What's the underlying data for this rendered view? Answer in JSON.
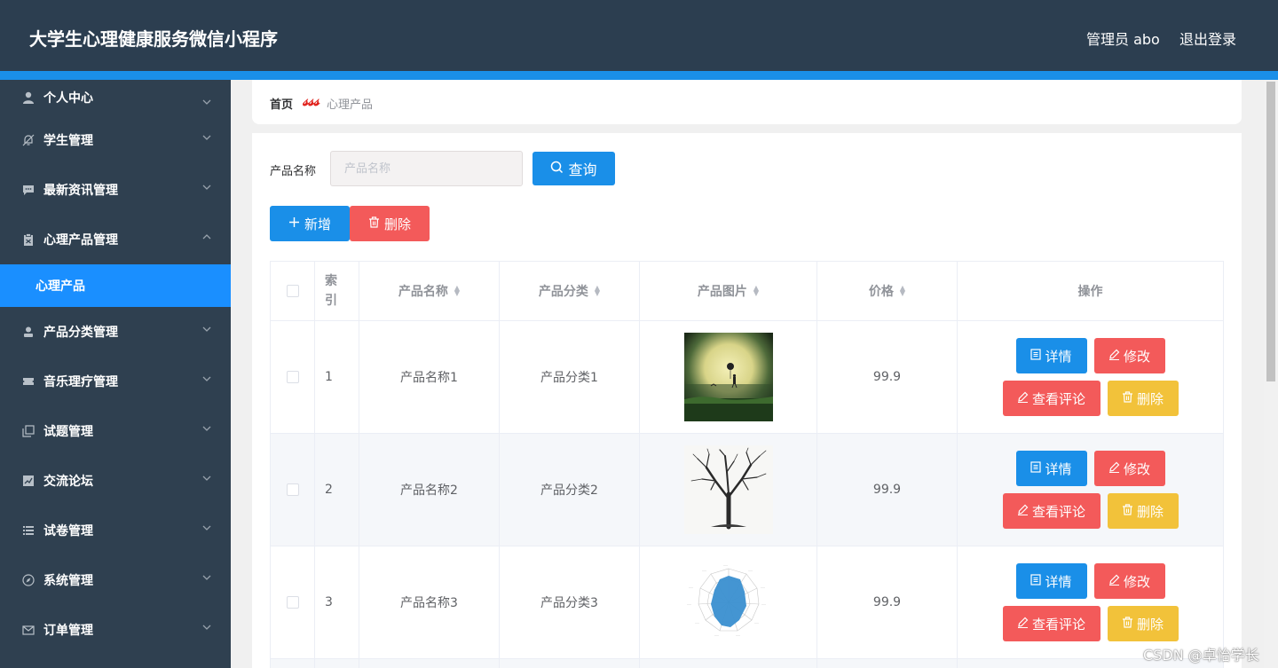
{
  "header": {
    "title": "大学生心理健康服务微信小程序",
    "user": "管理员 abo",
    "logout": "退出登录"
  },
  "sidebar": {
    "items": [
      {
        "label": "个人中心",
        "icon": "person-icon",
        "expanded": false
      },
      {
        "label": "学生管理",
        "icon": "bell-off-icon",
        "expanded": false
      },
      {
        "label": "最新资讯管理",
        "icon": "chat-icon",
        "expanded": false
      },
      {
        "label": "心理产品管理",
        "icon": "clipboard-icon",
        "expanded": true
      },
      {
        "label": "产品分类管理",
        "icon": "user-icon",
        "expanded": false
      },
      {
        "label": "音乐理疗管理",
        "icon": "ticket-icon",
        "expanded": false
      },
      {
        "label": "试题管理",
        "icon": "copy-icon",
        "expanded": false
      },
      {
        "label": "交流论坛",
        "icon": "chart-icon",
        "expanded": false
      },
      {
        "label": "试卷管理",
        "icon": "list-icon",
        "expanded": false
      },
      {
        "label": "系统管理",
        "icon": "compass-icon",
        "expanded": false
      },
      {
        "label": "订单管理",
        "icon": "mail-icon",
        "expanded": false
      }
    ],
    "active_sub": "心理产品"
  },
  "breadcrumb": {
    "home": "首页",
    "separator": "𝓈𝓈𝓈",
    "current": "心理产品"
  },
  "search": {
    "label": "产品名称",
    "placeholder": "产品名称",
    "value": "",
    "query_button": "查询"
  },
  "actions": {
    "add": "新增",
    "delete": "删除"
  },
  "table": {
    "headers": {
      "index": "索引",
      "name": "产品名称",
      "category": "产品分类",
      "image": "产品图片",
      "price": "价格",
      "ops": "操作"
    },
    "rows": [
      {
        "index": "1",
        "name": "产品名称1",
        "category": "产品分类1",
        "price": "99.9",
        "image": "moon-silhouette"
      },
      {
        "index": "2",
        "name": "产品名称2",
        "category": "产品分类2",
        "price": "99.9",
        "image": "bare-tree"
      },
      {
        "index": "3",
        "name": "产品名称3",
        "category": "产品分类3",
        "price": "99.9",
        "image": "radar-chart"
      }
    ],
    "op_labels": {
      "detail": "详情",
      "edit": "修改",
      "comment": "查看评论",
      "delete": "删除"
    }
  },
  "colors": {
    "topbar": "#2c3e50",
    "accent": "#1a8fe8",
    "sidebar": "#2f4050",
    "danger": "#f35a5a",
    "warning": "#f2c23a"
  },
  "watermark": "CSDN @卓怡学长"
}
